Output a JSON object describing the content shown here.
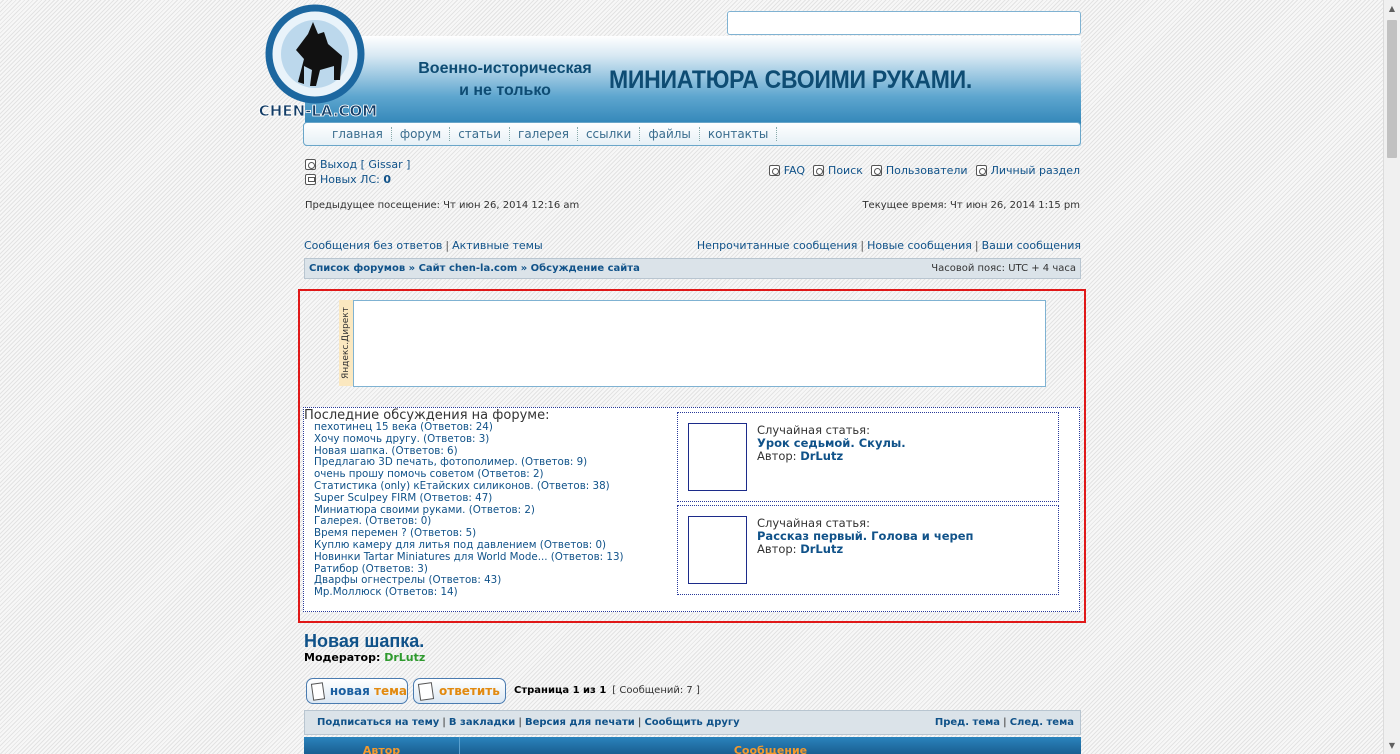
{
  "header": {
    "tagline_line1": "Военно-историческая",
    "tagline_line2": "и не только",
    "site_title": "МИНИАТЮРА СВОИМИ РУКАМИ.",
    "logo_text": "CHEN-LA.COM"
  },
  "nav": [
    "главная",
    "форум",
    "статьи",
    "галерея",
    "ссылки",
    "файлы",
    "контакты"
  ],
  "user": {
    "logout_label": "Выход [ Gissar ]",
    "new_pm_label": "Новых ЛС:",
    "new_pm_count": "0"
  },
  "top_links": [
    "FAQ",
    "Поиск",
    "Пользователи",
    "Личный раздел"
  ],
  "visits": {
    "previous": "Предыдущее посещение: Чт июн 26, 2014 12:16 am",
    "current": "Текущее время: Чт июн 26, 2014 1:15 pm"
  },
  "quick_left": [
    "Сообщения без ответов",
    "Активные темы"
  ],
  "quick_right": [
    "Непрочитанные сообщения",
    "Новые сообщения",
    "Ваши сообщения"
  ],
  "breadcrumb": {
    "path": "Список форумов » Сайт chen-la.com » Обсуждение сайта",
    "timezone": "Часовой пояс: UTC + 4 часа"
  },
  "direct": {
    "label": "Яндекс.Директ"
  },
  "latest": {
    "title": "Последние обсуждения на форуме:",
    "items": [
      "пехотинец 15 века (Ответов: 24)",
      "Хочу помочь другу. (Ответов: 3)",
      "Новая шапка. (Ответов: 6)",
      "Предлагаю 3D печать, фотополимер. (Ответов: 9)",
      "очень прошу помочь советом (Ответов: 2)",
      "Статистика (only) кЕтайских силиконов. (Ответов: 38)",
      "Super Sculpey FIRM (Ответов: 47)",
      "Миниатюра своими руками. (Ответов: 2)",
      "Галерея. (Ответов: 0)",
      "Время перемен ? (Ответов: 5)",
      "Куплю камеру для литья под давлением (Ответов: 0)",
      "Новинки Tartar Miniatures для World Mode... (Ответов: 13)",
      "Ратибор (Ответов: 3)",
      "Дварфы огнестрелы (Ответов: 43)",
      "Мр.Моллюск (Ответов: 14)"
    ]
  },
  "articles": [
    {
      "label": "Случайная статья:",
      "title": "Урок седьмой. Скулы.",
      "author_label": "Автор:",
      "author": "DrLutz"
    },
    {
      "label": "Случайная статья:",
      "title": "Рассказ первый. Голова и череп",
      "author_label": "Автор:",
      "author": "DrLutz"
    }
  ],
  "forum": {
    "title": "Новая шапка.",
    "moderator_label": "Модератор:",
    "moderator": "DrLutz"
  },
  "buttons": {
    "new_topic_1": "новая",
    "new_topic_2": "тема",
    "reply": "ответить"
  },
  "pagination": {
    "page": "Страница 1 из 1",
    "count": "[ Сообщений: 7 ]"
  },
  "actions": {
    "left": [
      "Подписаться на тему",
      "В закладки",
      "Версия для печати",
      "Сообщить другу"
    ],
    "right": [
      "Пред. тема",
      "След. тема"
    ]
  },
  "table_header": [
    "Автор",
    "Сообщение"
  ]
}
